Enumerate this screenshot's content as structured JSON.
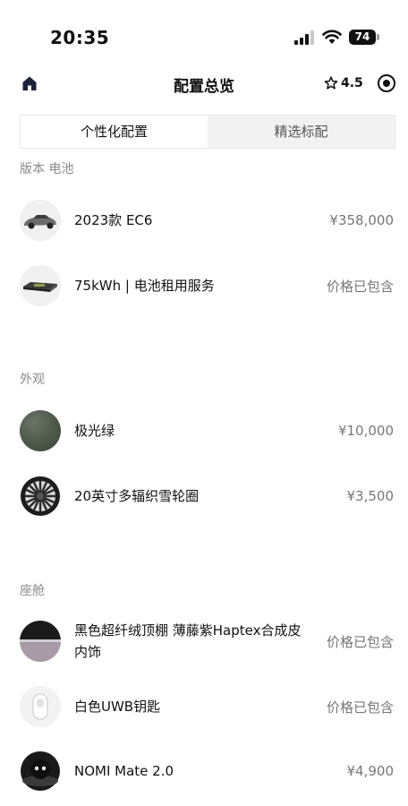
{
  "status_bar": {
    "time": "20:35",
    "battery": "74",
    "icons": [
      "signal-icon",
      "wifi-icon",
      "battery-icon"
    ]
  },
  "nav": {
    "title": "配置总览",
    "rating": "4.5",
    "icons": [
      "home-icon",
      "star-icon",
      "target-icon"
    ]
  },
  "tabs": [
    {
      "label": "个性化配置",
      "active": true
    },
    {
      "label": "精选标配",
      "active": false
    }
  ],
  "sections": {
    "version_battery": {
      "title": "版本 电池",
      "items": [
        {
          "name": "2023款 EC6",
          "price": "¥358,000",
          "thumb": "car-thumbnail"
        },
        {
          "name": "75kWh | 电池租用服务",
          "price": "价格已包含",
          "thumb": "battery-pack-thumbnail"
        }
      ]
    },
    "exterior": {
      "title": "外观",
      "items": [
        {
          "name": "极光绿",
          "price": "¥10,000",
          "thumb": "paint-swatch-green",
          "color": "#4d584b"
        },
        {
          "name": "20英寸多辐织雪轮圈",
          "price": "¥3,500",
          "thumb": "wheel-thumbnail"
        }
      ]
    },
    "cabin": {
      "title": "座舱",
      "items": [
        {
          "name": "黑色超纤绒顶棚 薄藤紫Haptex合成皮内饰",
          "price": "价格已包含",
          "thumb": "interior-swatch"
        },
        {
          "name": "白色UWB钥匙",
          "price": "价格已包含",
          "thumb": "key-fob-thumbnail"
        },
        {
          "name": "NOMI Mate 2.0",
          "price": "¥4,900",
          "thumb": "nomi-thumbnail"
        }
      ]
    }
  }
}
